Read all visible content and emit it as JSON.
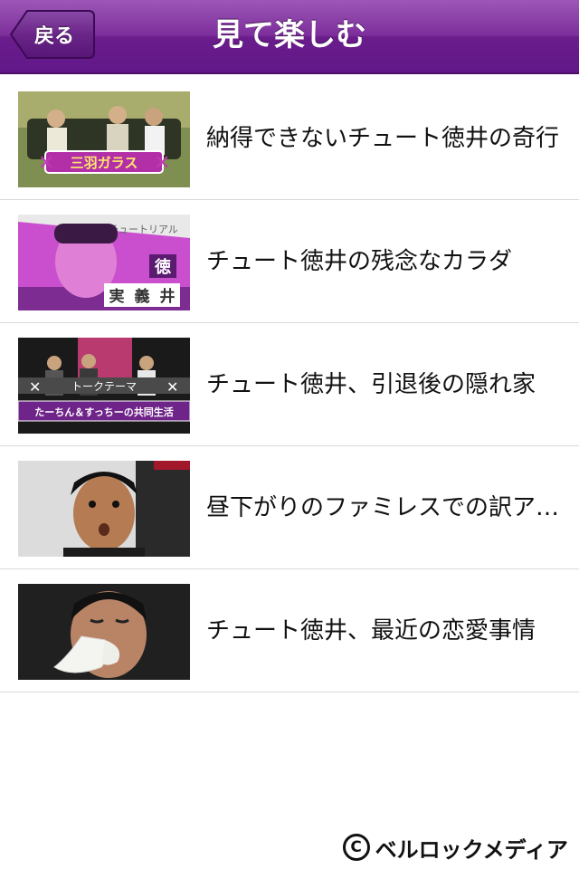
{
  "header": {
    "title": "見て楽しむ",
    "back_label": "戻る"
  },
  "items": [
    {
      "label": "納得できないチュート徳井の奇行"
    },
    {
      "label": "チュート徳井の残念なカラダ"
    },
    {
      "label": "チュート徳井、引退後の隠れ家"
    },
    {
      "label": "昼下がりのファミレスでの訳ア…"
    },
    {
      "label": "チュート徳井、最近の恋愛事情"
    }
  ],
  "thumbnails": {
    "t1_caption": "三羽ガラス",
    "t2_banner": "チュートリアル",
    "t2_chars": [
      "徳",
      "実",
      "義",
      "井"
    ],
    "t3_band": "トークテーマ",
    "t3_bottom": "たーちん＆すっちーの共同生活"
  },
  "footer": {
    "copyright": "ベルロックメディア",
    "copyright_symbol": "C"
  },
  "colors": {
    "navbar": "#7d2f9c",
    "separator": "#d9d9d9",
    "text": "#111111"
  }
}
